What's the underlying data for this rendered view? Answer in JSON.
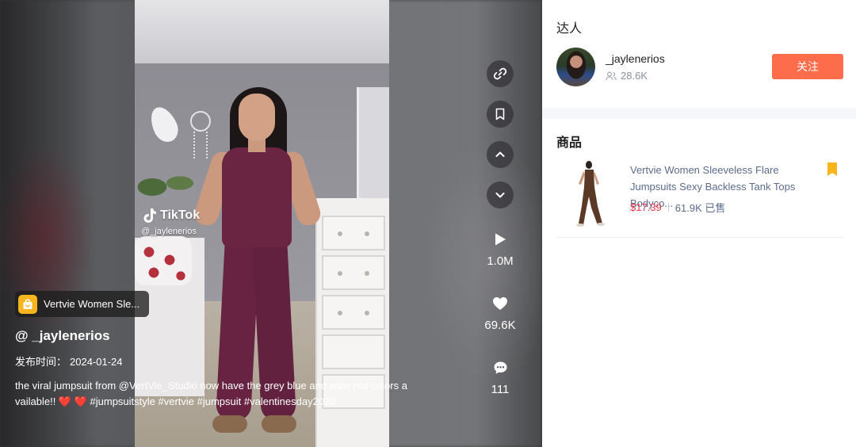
{
  "video": {
    "watermark_brand": "TikTok",
    "watermark_handle": "@_jaylenerios",
    "product_pill_label": "Vertvie Women Sle...",
    "author_handle": "@ _jaylenerios",
    "post_date_label": "发布时间：",
    "post_date_value": "2024-01-24",
    "caption": "the viral jumpsuit from @VertVie_Studio now have the grey blue and wine red colors available!! ❤️ ❤️ #jumpsuitstyle #vertvie #jumpsuit #valentinesday2020"
  },
  "actions": {
    "link_icon": "link-icon",
    "bookmark_icon": "bookmark-icon",
    "prev_icon": "chevron-up-icon",
    "next_icon": "chevron-down-icon",
    "plays": "1.0M",
    "likes": "69.6K",
    "comments": "111"
  },
  "creator": {
    "section_title": "达人",
    "name": "_jaylenerios",
    "followers": "28.6K",
    "follow_label": "关注"
  },
  "products": {
    "section_title": "商品",
    "items": [
      {
        "title": "Vertvie Women Sleeveless Flare Jumpsuits Sexy Backless Tank Tops Bodyco...",
        "price": "$17.39",
        "sold": "61.9K 已售"
      }
    ]
  },
  "colors": {
    "follow_button": "#fe6d4b",
    "price": "#f0384a",
    "bookmark": "#f6b51d",
    "product_title": "#5c6c8c"
  }
}
